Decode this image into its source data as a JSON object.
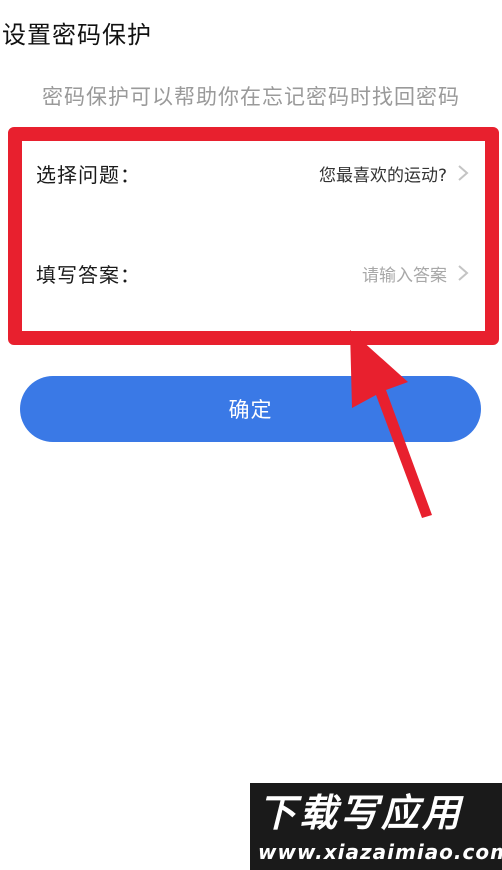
{
  "header": {
    "title": "设置密码保护"
  },
  "description": "密码保护可以帮助你在忘记密码时找回密码",
  "form": {
    "question": {
      "label": "选择问题：",
      "value": "您最喜欢的运动?"
    },
    "answer": {
      "label": "填写答案：",
      "placeholder": "请输入答案"
    }
  },
  "actions": {
    "confirm_label": "确定"
  },
  "icons": {
    "row_chevron": "chevron-right-icon",
    "annotation": "arrow-up-icon"
  },
  "colors": {
    "primary": "#3a79e6",
    "annotation": "#e8202e",
    "text": "#1a1a1a",
    "muted": "#9a9a9a"
  },
  "watermark": {
    "title": "下载写应用",
    "url": "www.xiazaimiao.com"
  }
}
